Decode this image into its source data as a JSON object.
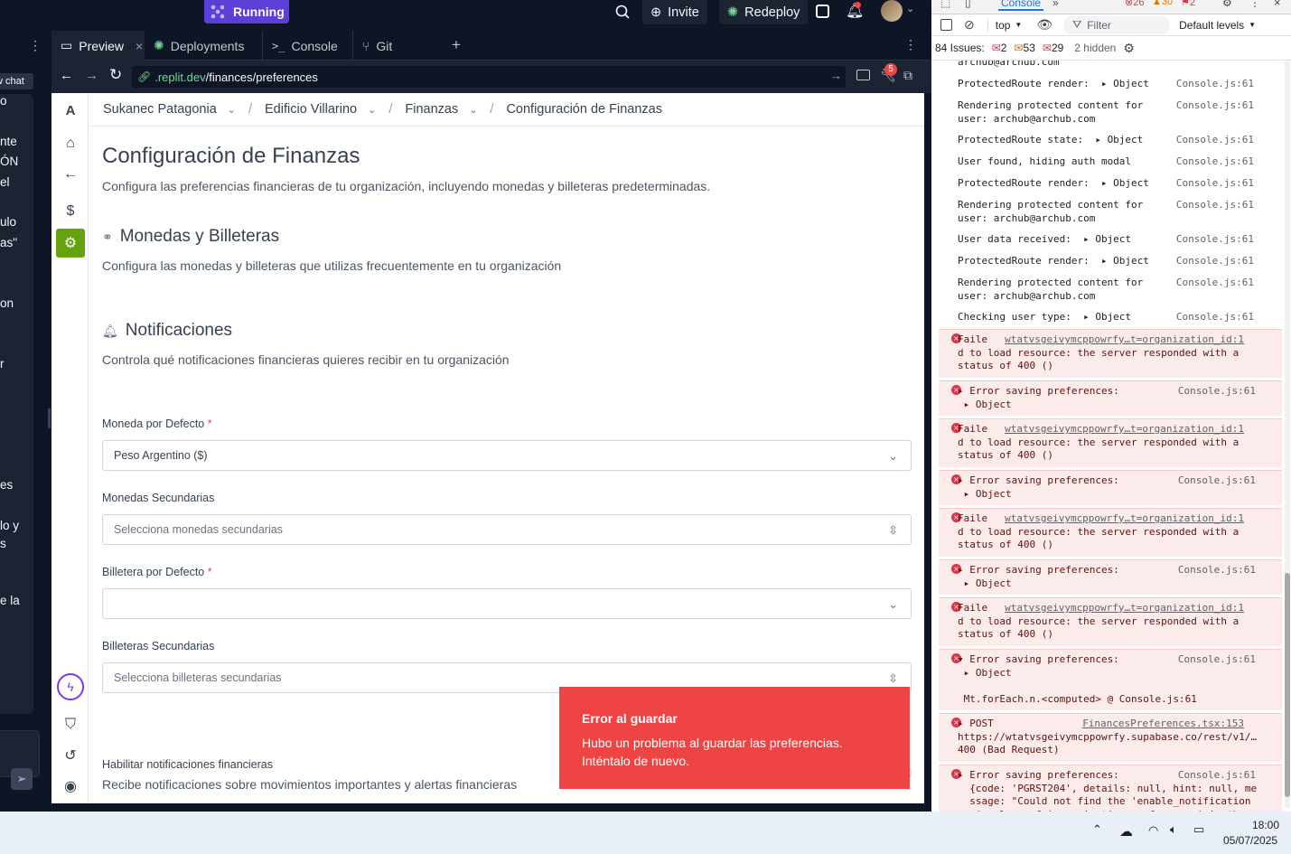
{
  "topbar": {
    "running": "Running",
    "invite": "Invite",
    "redeploy": "Redeploy",
    "notif_badge": "",
    "counts": {
      "a": "26",
      "b": "30",
      "c": "2"
    }
  },
  "leftpanel": {
    "chat": "w chat",
    "words": [
      "o",
      "nte",
      "ÓN",
      "el",
      "ulo",
      "as\"",
      "on",
      "r",
      "es",
      "lo y",
      "s",
      "e la"
    ]
  },
  "tabs": [
    {
      "label": "Preview"
    },
    {
      "label": "Deployments"
    },
    {
      "label": "Console"
    },
    {
      "label": "Git"
    }
  ],
  "url": {
    "domain": ".replit.dev",
    "path": "/finances/preferences",
    "badge": "5"
  },
  "breadcrumb": [
    "Sukanec Patagonia",
    "Edificio Villarino",
    "Finanzas",
    "Configuración de Finanzas"
  ],
  "rail": {
    "logo": "A"
  },
  "page": {
    "title": "Configuración de Finanzas",
    "subtitle": "Configura las preferencias financieras de tu organización, incluyendo monedas y billeteras predeterminadas.",
    "section1": {
      "title": "Monedas y Billeteras",
      "desc": "Configura las monedas y billeteras que utilizas frecuentemente en tu organización"
    },
    "section2": {
      "title": "Notificaciones",
      "desc": "Controla qué notificaciones financieras quieres recibir en tu organización"
    },
    "fields": {
      "default_currency": {
        "label": "Moneda por Defecto",
        "req": "*",
        "value": "Peso Argentino ($)"
      },
      "secondary_currencies": {
        "label": "Monedas Secundarias",
        "placeholder": "Selecciona monedas secundarias"
      },
      "default_wallet": {
        "label": "Billetera por Defecto",
        "req": "*",
        "value": ""
      },
      "secondary_wallets": {
        "label": "Billeteras Secundarias",
        "placeholder": "Selecciona billeteras secundarias"
      }
    },
    "notif_toggle": {
      "label": "Habilitar notificaciones financieras",
      "desc": "Recibe notificaciones sobre movimientos importantes y alertas financieras"
    }
  },
  "toast": {
    "title": "Error al guardar",
    "message": "Hubo un problema al guardar las preferencias. Inténtalo de nuevo."
  },
  "devtools": {
    "tab": "Console",
    "context": "top",
    "filter": "Filter",
    "levels": "Default levels",
    "issues": {
      "label": "84 Issues:",
      "errors": "2",
      "warnings": "53",
      "info": "29",
      "hidden": "2 hidden"
    },
    "logs": [
      {
        "type": "log",
        "msg": "archub@archub.com",
        "src": ""
      },
      {
        "type": "log",
        "msg": "ProtectedRoute render:  ▸ Object",
        "src": "Console.js:61"
      },
      {
        "type": "log",
        "msg": "Rendering protected content for\nuser: archub@archub.com",
        "src": "Console.js:61"
      },
      {
        "type": "log",
        "msg": "ProtectedRoute state:  ▸ Object",
        "src": "Console.js:61"
      },
      {
        "type": "log",
        "msg": "User found, hiding auth modal",
        "src": "Console.js:61"
      },
      {
        "type": "log",
        "msg": "ProtectedRoute render:  ▸ Object",
        "src": "Console.js:61"
      },
      {
        "type": "log",
        "msg": "Rendering protected content for\nuser: archub@archub.com",
        "src": "Console.js:61"
      },
      {
        "type": "log",
        "msg": "User data received:  ▸ Object",
        "src": "Console.js:61"
      },
      {
        "type": "log",
        "msg": "ProtectedRoute render:  ▸ Object",
        "src": "Console.js:61"
      },
      {
        "type": "log",
        "msg": "Rendering protected content for\nuser: archub@archub.com",
        "src": "Console.js:61"
      },
      {
        "type": "log",
        "msg": "Checking user type:  ▸ Object",
        "src": "Console.js:61"
      },
      {
        "type": "err",
        "link": "wtatvsgeivymcppowrfy…t=organization_id:1",
        "msg": "Faile\nd to load resource: the server responded with a\nstatus of 400 ()"
      },
      {
        "type": "err",
        "msg": "▸ Error saving preferences:\n ▸ Object",
        "src": "Console.js:61"
      },
      {
        "type": "err",
        "link": "wtatvsgeivymcppowrfy…t=organization_id:1",
        "msg": "Faile\nd to load resource: the server responded with a\nstatus of 400 ()"
      },
      {
        "type": "err",
        "msg": "▸ Error saving preferences:\n ▸ Object",
        "src": "Console.js:61"
      },
      {
        "type": "err",
        "link": "wtatvsgeivymcppowrfy…t=organization_id:1",
        "msg": "Faile\nd to load resource: the server responded with a\nstatus of 400 ()"
      },
      {
        "type": "err",
        "msg": "▸ Error saving preferences:\n ▸ Object",
        "src": "Console.js:61"
      },
      {
        "type": "err",
        "link": "wtatvsgeivymcppowrfy…t=organization_id:1",
        "msg": "Faile\nd to load resource: the server responded with a\nstatus of 400 ()"
      },
      {
        "type": "err",
        "msg": "▾ Error saving preferences:\n ▸ Object\n\n Mt.forEach.n.<computed> @ Console.js:61",
        "src": "Console.js:61"
      },
      {
        "type": "err",
        "link": "FinancesPreferences.tsx:153",
        "msg": "▸ POST\nhttps://wtatvsgeivymcppowrfy.supabase.co/rest/v1/…\n400 (Bad Request)"
      },
      {
        "type": "err",
        "msg": "▸ Error saving preferences:\n  {code: 'PGRST204', details: null, hint: null, me\n  ssage: \"Could not find the 'enable_notification\n  s' column of 'organization_preferences' in the s\n  chema cache\"}",
        "src": "Console.js:61"
      }
    ]
  },
  "taskbar": {
    "time": "18:00",
    "date": "05/07/2025"
  }
}
